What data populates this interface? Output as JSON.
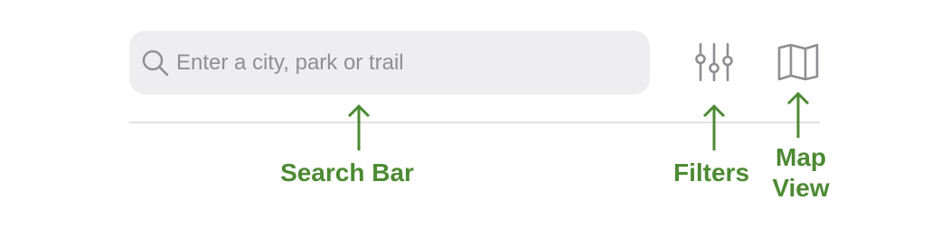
{
  "search": {
    "placeholder": "Enter a city, park or trail",
    "icon": "search-icon"
  },
  "toolbar": {
    "filters_icon": "sliders-icon",
    "map_icon": "folded-map-icon"
  },
  "annotations": {
    "search_bar": "Search Bar",
    "filters": "Filters",
    "map_view_line1": "Map",
    "map_view_line2": "View"
  },
  "colors": {
    "annotation_green": "#4d8a33",
    "search_background": "#eeeef0",
    "placeholder_gray": "#8f8f94",
    "icon_gray": "#8e8e92",
    "divider": "#e2e2e4"
  }
}
